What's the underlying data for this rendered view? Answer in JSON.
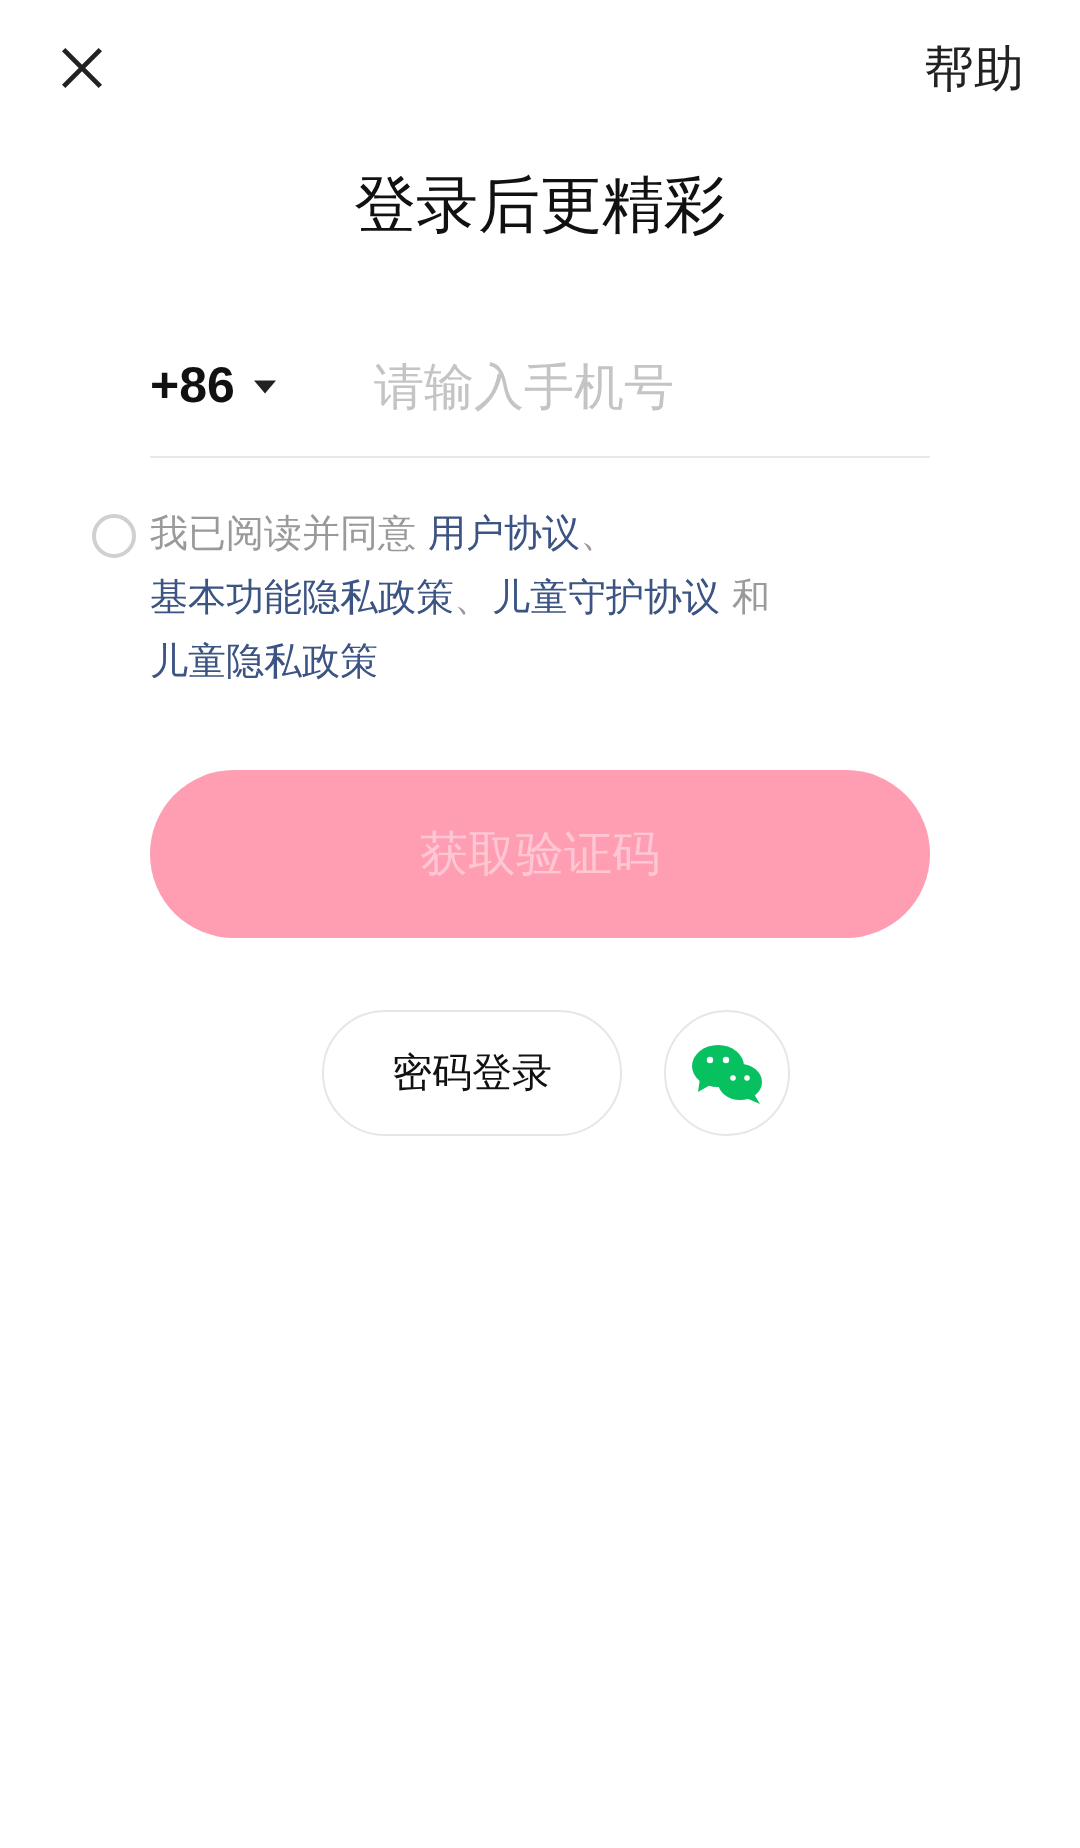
{
  "header": {
    "help": "帮助"
  },
  "title": "登录后更精彩",
  "phone": {
    "country_code": "+86",
    "placeholder": "请输入手机号"
  },
  "agreement": {
    "checked": false,
    "parts": [
      {
        "kind": "text",
        "text": "我已阅读并同意"
      },
      {
        "kind": "link",
        "text": "用户协议"
      },
      {
        "kind": "sep",
        "text": "、"
      },
      {
        "kind": "link",
        "text": "基本功能隐私政策"
      },
      {
        "kind": "sep",
        "text": "、"
      },
      {
        "kind": "link",
        "text": "儿童守护协议"
      },
      {
        "kind": "text",
        "text": "和"
      },
      {
        "kind": "link",
        "text": "儿童隐私政策"
      }
    ]
  },
  "submit": {
    "label": "获取验证码",
    "disabled": true
  },
  "alt_login": {
    "password_label": "密码登录"
  }
}
